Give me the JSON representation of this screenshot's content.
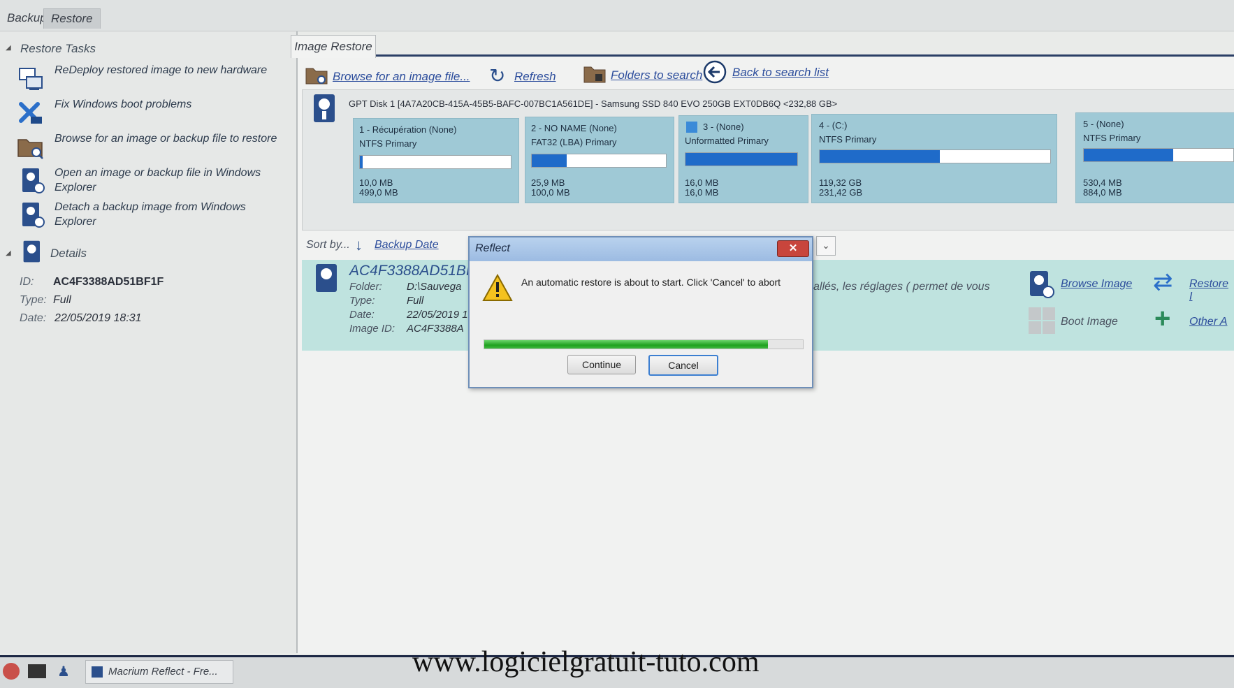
{
  "top_tabs": [
    "Backup",
    "Restore"
  ],
  "left": {
    "restore_tasks_title": "Restore Tasks",
    "tasks": [
      {
        "label": "ReDeploy restored image to new hardware",
        "icon": "redeploy-icon"
      },
      {
        "label": "Fix Windows boot problems",
        "icon": "fix-boot-icon"
      },
      {
        "label": "Browse for an image or backup file to restore",
        "icon": "browse-folder-icon"
      },
      {
        "label": "Open an image or backup file in Windows Explorer",
        "icon": "open-image-icon"
      },
      {
        "label": "Detach a backup image from Windows Explorer",
        "icon": "detach-image-icon"
      }
    ],
    "details_title": "Details",
    "details": {
      "id_label": "ID:",
      "id_value": "AC4F3388AD51BF1F",
      "type_label": "Type:",
      "type_value": "Full",
      "date_label": "Date:",
      "date_value": "22/05/2019 18:31"
    }
  },
  "main": {
    "tab_label": "Image Restore",
    "toolbar": {
      "browse": "Browse for an image file...",
      "refresh": "Refresh",
      "folders": "Folders to search",
      "back": "Back to search list"
    },
    "disk": {
      "header": "GPT Disk 1 [4A7A20CB-415A-45B5-BAFC-007BC1A561DE] - Samsung SSD 840 EVO 250GB EXT0DB6Q  <232,88 GB>",
      "partitions": [
        {
          "name": "1 - Récupération (None)",
          "fs": "NTFS Primary",
          "used": "10,0 MB",
          "total": "499,0 MB",
          "fill": 0.02
        },
        {
          "name": "2 - NO NAME (None)",
          "fs": "FAT32 (LBA) Primary",
          "used": "25,9 MB",
          "total": "100,0 MB",
          "fill": 0.26
        },
        {
          "name": "3 - (None)",
          "fs": "Unformatted Primary",
          "used": "16,0 MB",
          "total": "16,0 MB",
          "fill": 1.0
        },
        {
          "name": "4 - (C:)",
          "fs": "NTFS Primary",
          "used": "119,32 GB",
          "total": "231,42 GB",
          "fill": 0.52
        },
        {
          "name": "5 - (None)",
          "fs": "NTFS Primary",
          "used": "530,4 MB",
          "total": "884,0 MB",
          "fill": 0.6
        }
      ]
    },
    "sort_label": "Sort by...",
    "sort_value": "Backup Date",
    "image": {
      "id": "AC4F3388AD51BI",
      "folder_label": "Folder:",
      "folder_value": "D:\\Sauvega",
      "type_label": "Type:",
      "type_value": "Full",
      "date_label": "Date:",
      "date_value": "22/05/2019 1",
      "imageid_label": "Image ID:",
      "imageid_value": "AC4F3388A",
      "comment": "allés, les réglages ( permet de vous"
    },
    "ops": {
      "browse_image": "Browse Image",
      "restore": "Restore I",
      "boot_image": "Boot Image",
      "other": "Other A"
    }
  },
  "dialog": {
    "title": "Reflect",
    "close": "✕",
    "message": "An automatic restore is about to start. Click 'Cancel' to abort",
    "progress": 0.89,
    "continue": "Continue",
    "cancel": "Cancel"
  },
  "taskbar": {
    "app": "Macrium Reflect - Fre..."
  },
  "watermark": "www.logicielgratuit-tuto.com"
}
